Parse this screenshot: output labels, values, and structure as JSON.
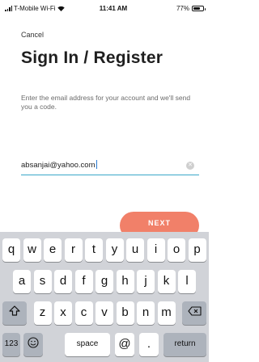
{
  "status_bar": {
    "carrier": "T-Mobile Wi-Fi",
    "time": "11:41 AM",
    "battery": "77%",
    "battery_level": 0.77
  },
  "nav": {
    "cancel_label": "Cancel"
  },
  "page": {
    "title": "Sign In / Register",
    "subtitle": "Enter the email address for your account and we'll send you a code."
  },
  "form": {
    "email_value": "absanjai@yahoo.com",
    "next_label": "NEXT"
  },
  "keyboard": {
    "row1": [
      "q",
      "w",
      "e",
      "r",
      "t",
      "y",
      "u",
      "i",
      "o",
      "p"
    ],
    "row2": [
      "a",
      "s",
      "d",
      "f",
      "g",
      "h",
      "j",
      "k",
      "l"
    ],
    "row3": [
      "z",
      "x",
      "c",
      "v",
      "b",
      "n",
      "m"
    ],
    "numbers_label": "123",
    "space_label": "space",
    "at_label": "@",
    "dot_label": ".",
    "return_label": "return"
  }
}
